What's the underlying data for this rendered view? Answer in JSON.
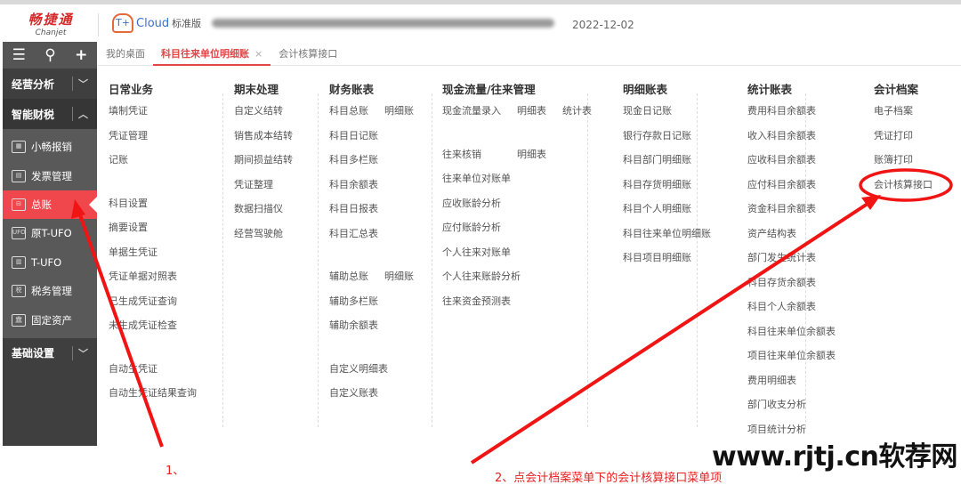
{
  "header": {
    "logo_cn": "畅捷通",
    "logo_en": "Chanjet",
    "product": "T+",
    "product_cloud": "Cloud",
    "edition": "标准版",
    "date": "2022-12-02"
  },
  "sidebar": {
    "tools": [
      "menu-icon",
      "search-icon",
      "plus-icon"
    ],
    "groups": [
      {
        "label": "经营分析",
        "state": "collapsed"
      },
      {
        "label": "智能财税",
        "state": "expanded"
      },
      {
        "label": "基础设置",
        "state": "collapsed"
      }
    ],
    "items": [
      {
        "label": "小畅报销",
        "icon": "reimburse-icon"
      },
      {
        "label": "发票管理",
        "icon": "invoice-icon"
      },
      {
        "label": "总账",
        "icon": "ledger-icon",
        "active": true
      },
      {
        "label": "原T-UFO",
        "icon": "ufo-file-icon"
      },
      {
        "label": "T-UFO",
        "icon": "ufo-icon"
      },
      {
        "label": "税务管理",
        "icon": "tax-icon"
      },
      {
        "label": "固定资产",
        "icon": "bank-icon"
      }
    ]
  },
  "tabs": [
    {
      "label": "我的桌面"
    },
    {
      "label": "科目往来单位明细账",
      "active": true
    },
    {
      "label": "会计核算接口"
    }
  ],
  "menu": [
    {
      "title": "日常业务",
      "groups": [
        [
          "填制凭证",
          "凭证管理",
          "记账"
        ],
        [
          "科目设置",
          "摘要设置",
          "单据生凭证",
          "凭证单据对照表",
          "已生成凭证查询",
          "未生成凭证检查"
        ],
        [
          "自动生凭证",
          "自动生凭证结果查询"
        ]
      ]
    },
    {
      "title": "期末处理",
      "groups": [
        [
          "自定义结转",
          "销售成本结转",
          "期间损益结转",
          "凭证整理",
          "数据扫描仪",
          "经营驾驶舱"
        ]
      ]
    },
    {
      "title": "财务账表",
      "groups": [
        [
          "科目总账|明细账",
          "科目日记账",
          "科目多栏账",
          "科目余额表",
          "科目日报表",
          "科目汇总表"
        ],
        [
          "辅助总账|明细账",
          "辅助多栏账",
          "辅助余额表"
        ],
        [
          "自定义明细表",
          "自定义账表"
        ]
      ]
    },
    {
      "title": "现金流量/往来管理",
      "groups": [
        [
          "现金流量录入|明细表|统计表"
        ],
        [
          "往来核销|明细表",
          "往来单位对账单",
          "应收账龄分析",
          "应付账龄分析",
          "个人往来对账单",
          "个人往来账龄分析",
          "往来资金预测表"
        ]
      ]
    },
    {
      "title": "明细账表",
      "groups": [
        [
          "现金日记账",
          "银行存款日记账",
          "科目部门明细账",
          "科目存货明细账",
          "科目个人明细账",
          "科目往来单位明细账",
          "科目项目明细账"
        ]
      ]
    },
    {
      "title": "统计账表",
      "groups": [
        [
          "费用科目余额表",
          "收入科目余额表",
          "应收科目余额表",
          "应付科目余额表",
          "资金科目余额表",
          "资产结构表",
          "部门发生统计表",
          "科目存货余额表",
          "科目个人余额表",
          "科目往来单位余额表",
          "项目往来单位余额表",
          "费用明细表",
          "部门收支分析",
          "项目统计分析"
        ]
      ]
    },
    {
      "title": "会计档案",
      "groups": [
        [
          "电子档案",
          "凭证打印",
          "账簿打印",
          "会计核算接口"
        ]
      ]
    }
  ],
  "annotations": {
    "step1": "1、",
    "step2": "2、点会计档案菜单下的会计核算接口菜单项",
    "color": "#e82020"
  },
  "watermark": "www.rjtj.cn软荐网",
  "colors": {
    "accent": "#f0474d",
    "sidebar": "#3f3f3f"
  }
}
